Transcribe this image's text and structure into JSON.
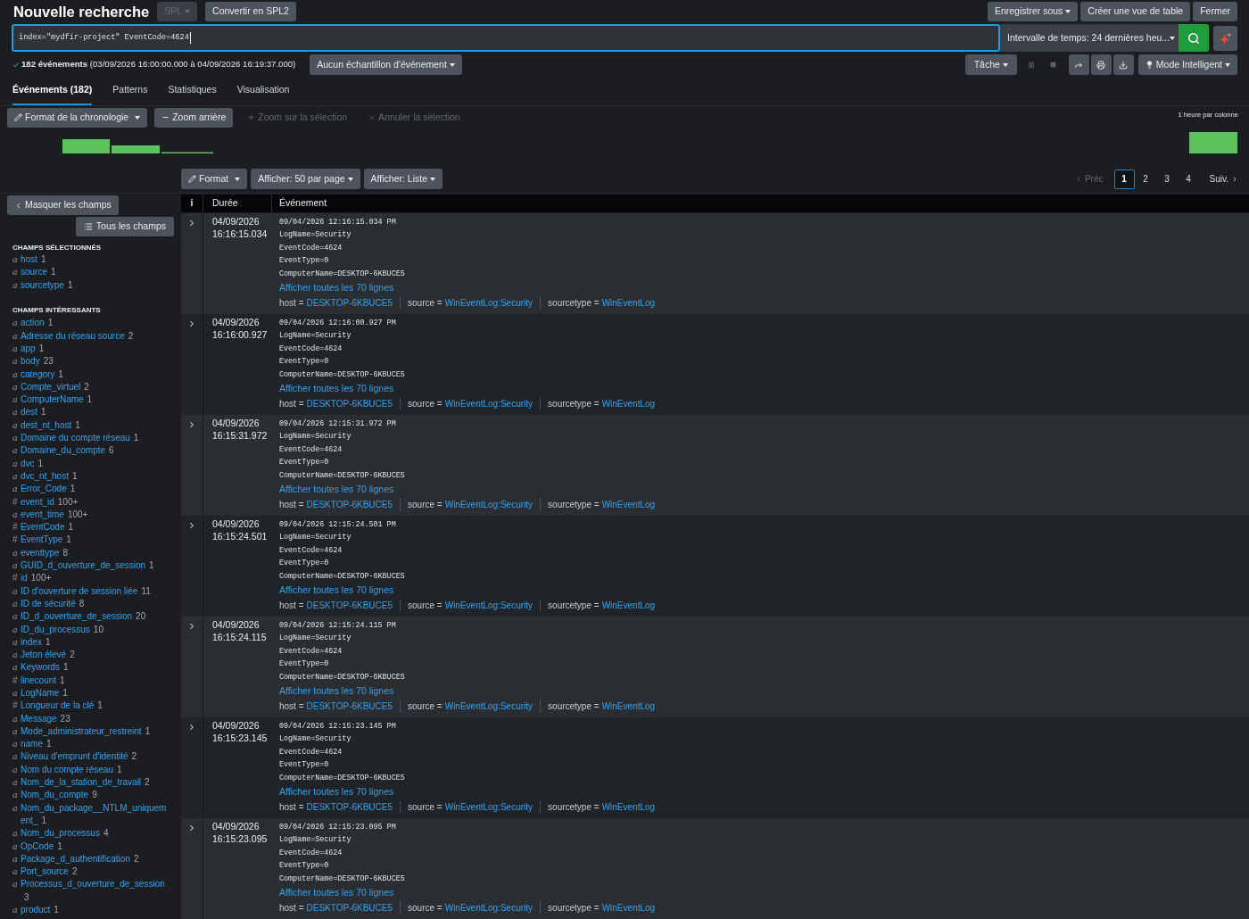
{
  "header": {
    "title": "Nouvelle recherche",
    "buttons": [
      {
        "label": "SPL",
        "kind": "dropdown",
        "disabled": true
      },
      {
        "label": "Convertir en SPL2",
        "kind": "plain",
        "disabled": false
      }
    ],
    "actions": [
      {
        "label": "Enregistrer sous",
        "kind": "dropdown"
      },
      {
        "label": "Créer une vue de table",
        "kind": "plain"
      },
      {
        "label": "Fermer",
        "kind": "plain"
      }
    ]
  },
  "search": {
    "query": "index=\"mydfir-project\" EventCode=4624",
    "time_range": "Intervalle de temps: 24 dernières heu..."
  },
  "status": {
    "summary": "**182 événements** (03/09/2026 16:00:00.000 à 04/09/2026 16:19:37.000)",
    "sampling": "Aucun échantillon d'événement",
    "job": "Tâche",
    "mode": "Mode Intelligent"
  },
  "tabs": [
    {
      "label": "Événements (182)",
      "selected": true
    },
    {
      "label": "Patterns",
      "selected": false
    },
    {
      "label": "Statistiques",
      "selected": false
    },
    {
      "label": "Visualisation",
      "selected": false
    }
  ],
  "timeline": {
    "buttons": [
      {
        "label": "Format de la chronologie",
        "kind": "format",
        "disabled": false
      },
      {
        "label": "Zoom arrière",
        "kind": "zoom_out",
        "disabled": false
      },
      {
        "label": "Zoom sur la sélection",
        "kind": "zoom_in",
        "disabled": true
      },
      {
        "label": "Annuler la sélection",
        "kind": "clear",
        "disabled": true
      }
    ],
    "scale": "1 heure par colonne"
  },
  "results_toolbar": {
    "buttons": [
      {
        "label": "Format",
        "kind": "format"
      },
      {
        "label": "Afficher: 50 par page",
        "kind": "menu"
      },
      {
        "label": "Afficher: Liste",
        "kind": "menu"
      }
    ],
    "pagination": {
      "prev": {
        "label": "Préc",
        "disabled": true
      },
      "pages": [
        {
          "label": "1",
          "selected": true
        },
        {
          "label": "2",
          "selected": false
        },
        {
          "label": "3",
          "selected": false
        },
        {
          "label": "4",
          "selected": false
        }
      ],
      "next": {
        "label": "Suiv.",
        "disabled": false
      }
    }
  },
  "sidebar": {
    "hide_button": "Masquer les champs",
    "all_fields_button": "Tous les champs",
    "sections": [
      {
        "title": "CHAMPS SÉLECTIONNÉS",
        "fields": [
          {
            "type": "a",
            "name": "host",
            "count": "1"
          },
          {
            "type": "a",
            "name": "source",
            "count": "1"
          },
          {
            "type": "a",
            "name": "sourcetype",
            "count": "1"
          }
        ]
      },
      {
        "title": "CHAMPS INTÉRESSANTS",
        "fields": [
          {
            "type": "a",
            "name": "action",
            "count": "1"
          },
          {
            "type": "a",
            "name": "Adresse du réseau source",
            "count": "2"
          },
          {
            "type": "a",
            "name": "app",
            "count": "1"
          },
          {
            "type": "a",
            "name": "body",
            "count": "23"
          },
          {
            "type": "a",
            "name": "category",
            "count": "1"
          },
          {
            "type": "a",
            "name": "Compte_virtuel",
            "count": "2"
          },
          {
            "type": "a",
            "name": "ComputerName",
            "count": "1"
          },
          {
            "type": "a",
            "name": "dest",
            "count": "1"
          },
          {
            "type": "a",
            "name": "dest_nt_host",
            "count": "1"
          },
          {
            "type": "a",
            "name": "Domaine du compte réseau",
            "count": "1"
          },
          {
            "type": "a",
            "name": "Domaine_du_compte",
            "count": "6"
          },
          {
            "type": "a",
            "name": "dvc",
            "count": "1"
          },
          {
            "type": "a",
            "name": "dvc_nt_host",
            "count": "1"
          },
          {
            "type": "a",
            "name": "Error_Code",
            "count": "1"
          },
          {
            "type": "#",
            "name": "event_id",
            "count": "100+"
          },
          {
            "type": "a",
            "name": "event_time",
            "count": "100+"
          },
          {
            "type": "#",
            "name": "EventCode",
            "count": "1"
          },
          {
            "type": "#",
            "name": "EventType",
            "count": "1"
          },
          {
            "type": "a",
            "name": "eventtype",
            "count": "8"
          },
          {
            "type": "a",
            "name": "GUID_d_ouverture_de_session",
            "count": "1"
          },
          {
            "type": "#",
            "name": "id",
            "count": "100+"
          },
          {
            "type": "a",
            "name": "ID d'ouverture de session liée",
            "count": "11"
          },
          {
            "type": "a",
            "name": "ID de sécurité",
            "count": "8"
          },
          {
            "type": "a",
            "name": "ID_d_ouverture_de_session",
            "count": "20"
          },
          {
            "type": "a",
            "name": "ID_du_processus",
            "count": "10"
          },
          {
            "type": "a",
            "name": "index",
            "count": "1"
          },
          {
            "type": "a",
            "name": "Jeton élevé",
            "count": "2"
          },
          {
            "type": "a",
            "name": "Keywords",
            "count": "1"
          },
          {
            "type": "#",
            "name": "linecount",
            "count": "1"
          },
          {
            "type": "a",
            "name": "LogName",
            "count": "1"
          },
          {
            "type": "#",
            "name": "Longueur de la clé",
            "count": "1"
          },
          {
            "type": "a",
            "name": "Message",
            "count": "23"
          },
          {
            "type": "a",
            "name": "Mode_administrateur_restreint",
            "count": "1"
          },
          {
            "type": "a",
            "name": "name",
            "count": "1"
          },
          {
            "type": "a",
            "name": "Niveau d'emprunt d'identité",
            "count": "2"
          },
          {
            "type": "a",
            "name": "Nom du compte réseau",
            "count": "1"
          },
          {
            "type": "a",
            "name": "Nom_de_la_station_de_travail",
            "count": "2"
          },
          {
            "type": "a",
            "name": "Nom_du_compte",
            "count": "9"
          },
          {
            "type": "a",
            "name": "Nom_du_package__NTLM_uniquement_",
            "count": "1"
          },
          {
            "type": "a",
            "name": "Nom_du_processus",
            "count": "4"
          },
          {
            "type": "a",
            "name": "OpCode",
            "count": "1"
          },
          {
            "type": "a",
            "name": "Package_d_authentification",
            "count": "2"
          },
          {
            "type": "a",
            "name": "Port_source",
            "count": "2"
          },
          {
            "type": "a",
            "name": "Processus_d_ouverture_de_session",
            "count": "3"
          },
          {
            "type": "a",
            "name": "product",
            "count": "1"
          }
        ]
      }
    ]
  },
  "table": {
    "columns": [
      "i",
      "Durée",
      "Événement"
    ],
    "events": [
      {
        "date": "04/09/2026",
        "time": "16:16:15.034",
        "lines": [
          "09/04/2026 12:16:15.034 PM",
          "LogName=Security",
          "EventCode=4624",
          "EventType=0",
          "ComputerName=DESKTOP-6KBUCE5"
        ],
        "more": "Afficher toutes les 70 lignes",
        "fields": [
          {
            "label": "host =",
            "value": "DESKTOP-6KBUCE5"
          },
          {
            "label": "source =",
            "value": "WinEventLog:Security"
          },
          {
            "label": "sourcetype =",
            "value": "WinEventLog"
          }
        ]
      },
      {
        "date": "04/09/2026",
        "time": "16:16:00.927",
        "lines": [
          "09/04/2026 12:16:00.927 PM",
          "LogName=Security",
          "EventCode=4624",
          "EventType=0",
          "ComputerName=DESKTOP-6KBUCE5"
        ],
        "more": "Afficher toutes les 70 lignes",
        "fields": [
          {
            "label": "host =",
            "value": "DESKTOP-6KBUCE5"
          },
          {
            "label": "source =",
            "value": "WinEventLog:Security"
          },
          {
            "label": "sourcetype =",
            "value": "WinEventLog"
          }
        ]
      },
      {
        "date": "04/09/2026",
        "time": "16:15:31.972",
        "lines": [
          "09/04/2026 12:15:31.972 PM",
          "LogName=Security",
          "EventCode=4624",
          "EventType=0",
          "ComputerName=DESKTOP-6KBUCE5"
        ],
        "more": "Afficher toutes les 70 lignes",
        "fields": [
          {
            "label": "host =",
            "value": "DESKTOP-6KBUCE5"
          },
          {
            "label": "source =",
            "value": "WinEventLog:Security"
          },
          {
            "label": "sourcetype =",
            "value": "WinEventLog"
          }
        ]
      },
      {
        "date": "04/09/2026",
        "time": "16:15:24.501",
        "lines": [
          "09/04/2026 12:15:24.501 PM",
          "LogName=Security",
          "EventCode=4624",
          "EventType=0",
          "ComputerName=DESKTOP-6KBUCE5"
        ],
        "more": "Afficher toutes les 70 lignes",
        "fields": [
          {
            "label": "host =",
            "value": "DESKTOP-6KBUCE5"
          },
          {
            "label": "source =",
            "value": "WinEventLog:Security"
          },
          {
            "label": "sourcetype =",
            "value": "WinEventLog"
          }
        ]
      },
      {
        "date": "04/09/2026",
        "time": "16:15:24.115",
        "lines": [
          "09/04/2026 12:15:24.115 PM",
          "LogName=Security",
          "EventCode=4624",
          "EventType=0",
          "ComputerName=DESKTOP-6KBUCE5"
        ],
        "more": "Afficher toutes les 70 lignes",
        "fields": [
          {
            "label": "host =",
            "value": "DESKTOP-6KBUCE5"
          },
          {
            "label": "source =",
            "value": "WinEventLog:Security"
          },
          {
            "label": "sourcetype =",
            "value": "WinEventLog"
          }
        ]
      },
      {
        "date": "04/09/2026",
        "time": "16:15:23.145",
        "lines": [
          "09/04/2026 12:15:23.145 PM",
          "LogName=Security",
          "EventCode=4624",
          "EventType=0",
          "ComputerName=DESKTOP-6KBUCE5"
        ],
        "more": "Afficher toutes les 70 lignes",
        "fields": [
          {
            "label": "host =",
            "value": "DESKTOP-6KBUCE5"
          },
          {
            "label": "source =",
            "value": "WinEventLog:Security"
          },
          {
            "label": "sourcetype =",
            "value": "WinEventLog"
          }
        ]
      },
      {
        "date": "04/09/2026",
        "time": "16:15:23.095",
        "lines": [
          "09/04/2026 12:15:23.095 PM",
          "LogName=Security",
          "EventCode=4624",
          "EventType=0",
          "ComputerName=DESKTOP-6KBUCE5"
        ],
        "more": "Afficher toutes les 70 lignes",
        "fields": [
          {
            "label": "host =",
            "value": "DESKTOP-6KBUCE5"
          },
          {
            "label": "source =",
            "value": "WinEventLog:Security"
          },
          {
            "label": "sourcetype =",
            "value": "WinEventLog"
          }
        ]
      }
    ]
  }
}
